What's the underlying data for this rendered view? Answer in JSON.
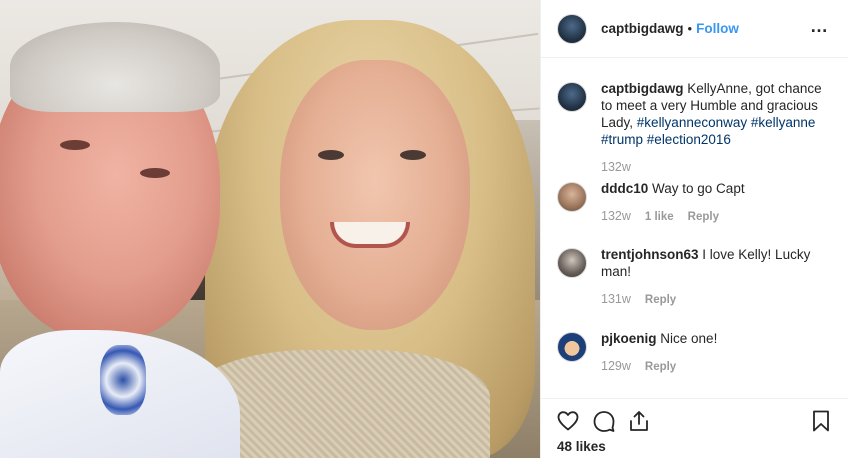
{
  "header": {
    "username": "captbigdawg",
    "separator": "•",
    "follow_label": "Follow",
    "more_label": "…",
    "avatar_icon": "profile-avatar-icon"
  },
  "caption": {
    "username": "captbigdawg",
    "text": "KellyAnne, got chance to meet a very Humble and gracious Lady,",
    "hashtags": [
      "#kellyanneconway",
      "#kellyanne",
      "#trump",
      "#election2016"
    ],
    "time": "132w"
  },
  "comments": [
    {
      "username": "dddc10",
      "text": "Way to go Capt",
      "time": "132w",
      "likes": "1 like",
      "reply": "Reply"
    },
    {
      "username": "trentjohnson63",
      "text": "I love Kelly! Lucky man!",
      "time": "131w",
      "reply": "Reply"
    },
    {
      "username": "pjkoenig",
      "text": "Nice one!",
      "time": "129w",
      "reply": "Reply"
    }
  ],
  "actions": {
    "icons": [
      "heart-icon",
      "comment-icon",
      "share-icon",
      "bookmark-icon"
    ],
    "likes_label": "48 likes"
  },
  "colors": {
    "link_blue": "#3897f0",
    "hashtag_blue": "#003569",
    "text": "#262626",
    "muted": "#999999",
    "border": "#efefef"
  }
}
